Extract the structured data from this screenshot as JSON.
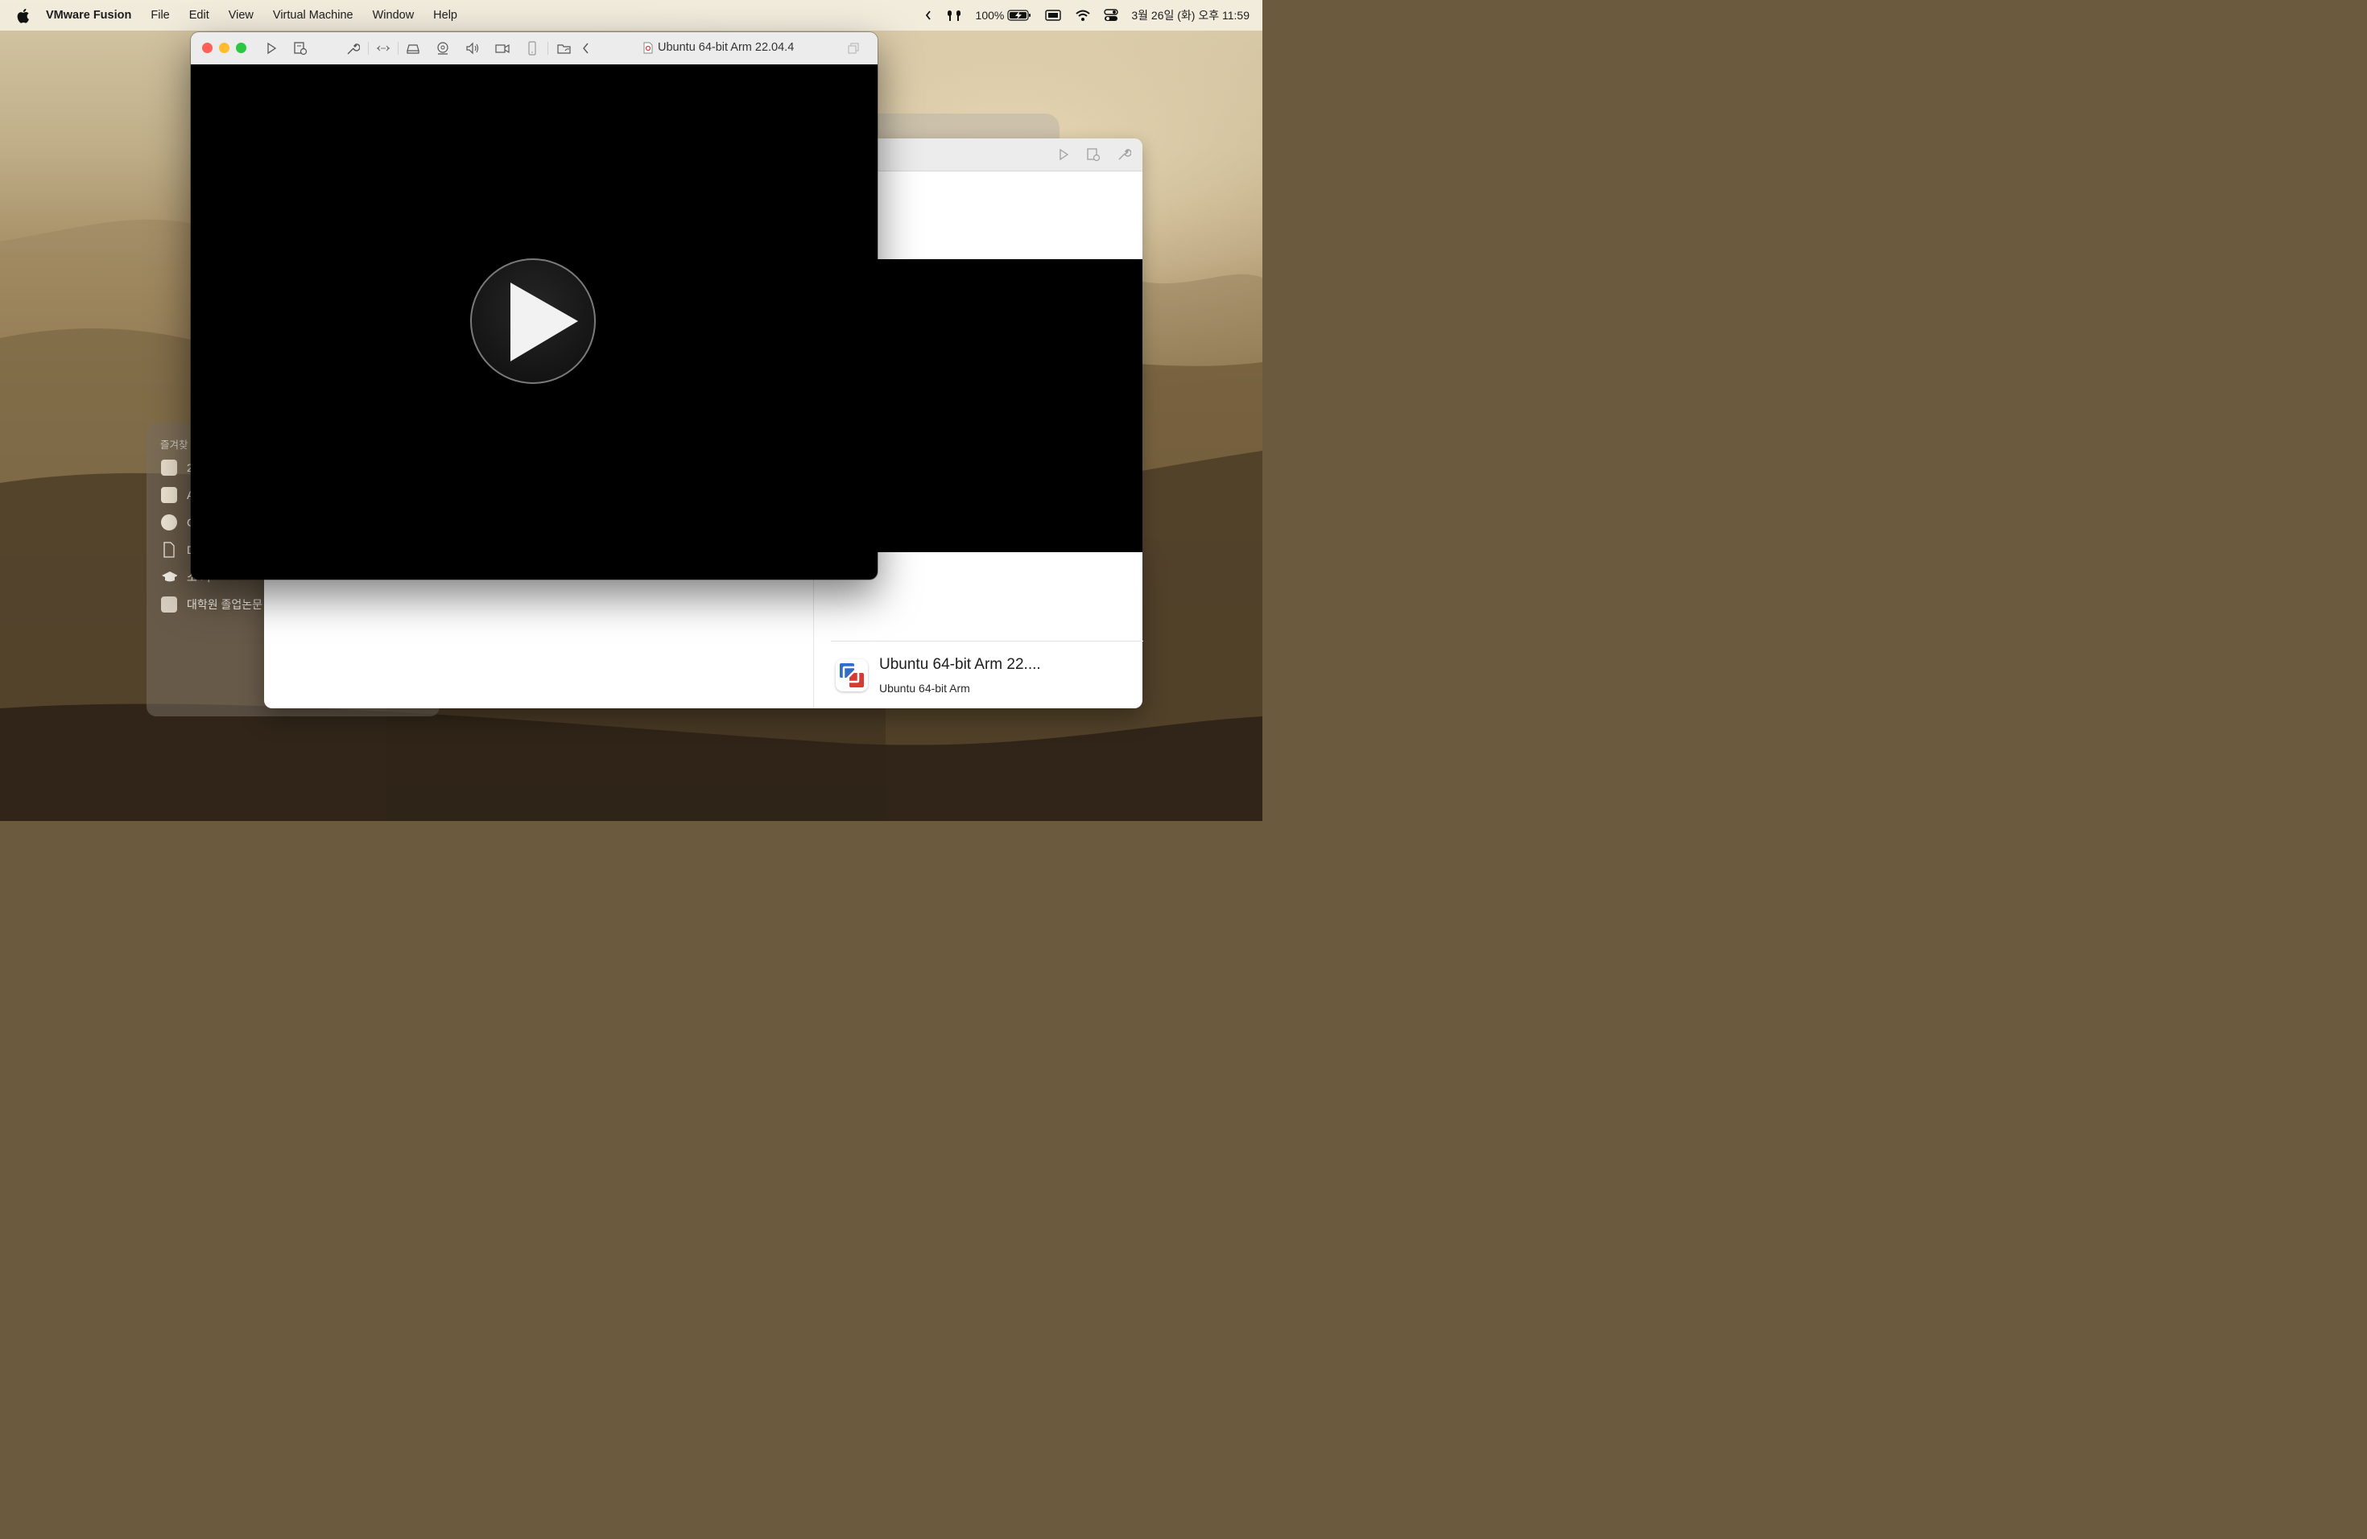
{
  "menubar": {
    "app_name": "VMware Fusion",
    "items": [
      "File",
      "Edit",
      "View",
      "Virtual Machine",
      "Window",
      "Help"
    ],
    "battery": "100%",
    "datetime": "3월 26일 (화) 오후 11:59"
  },
  "vm_window": {
    "title": "Ubuntu 64-bit Arm 22.04.4",
    "toolbar_icons": [
      "play-icon",
      "snapshot-icon",
      "settings-wrench-icon",
      "network-icon",
      "disk-icon",
      "camera-icon",
      "sound-icon",
      "video-icon",
      "usb-device-icon",
      "shared-folder-icon",
      "chevron-left-icon"
    ]
  },
  "library": {
    "vm_name": "Ubuntu 64-bit Arm 22....",
    "vm_os": "Ubuntu 64-bit Arm"
  },
  "sidebar": {
    "section": "즐겨찾",
    "items": [
      "2",
      "A",
      "C",
      "D",
      "소 기",
      "대학원 졸업논문 "
    ]
  },
  "colors": {
    "close": "#ff5f57",
    "minimize": "#febc2e",
    "zoom": "#28c840"
  }
}
